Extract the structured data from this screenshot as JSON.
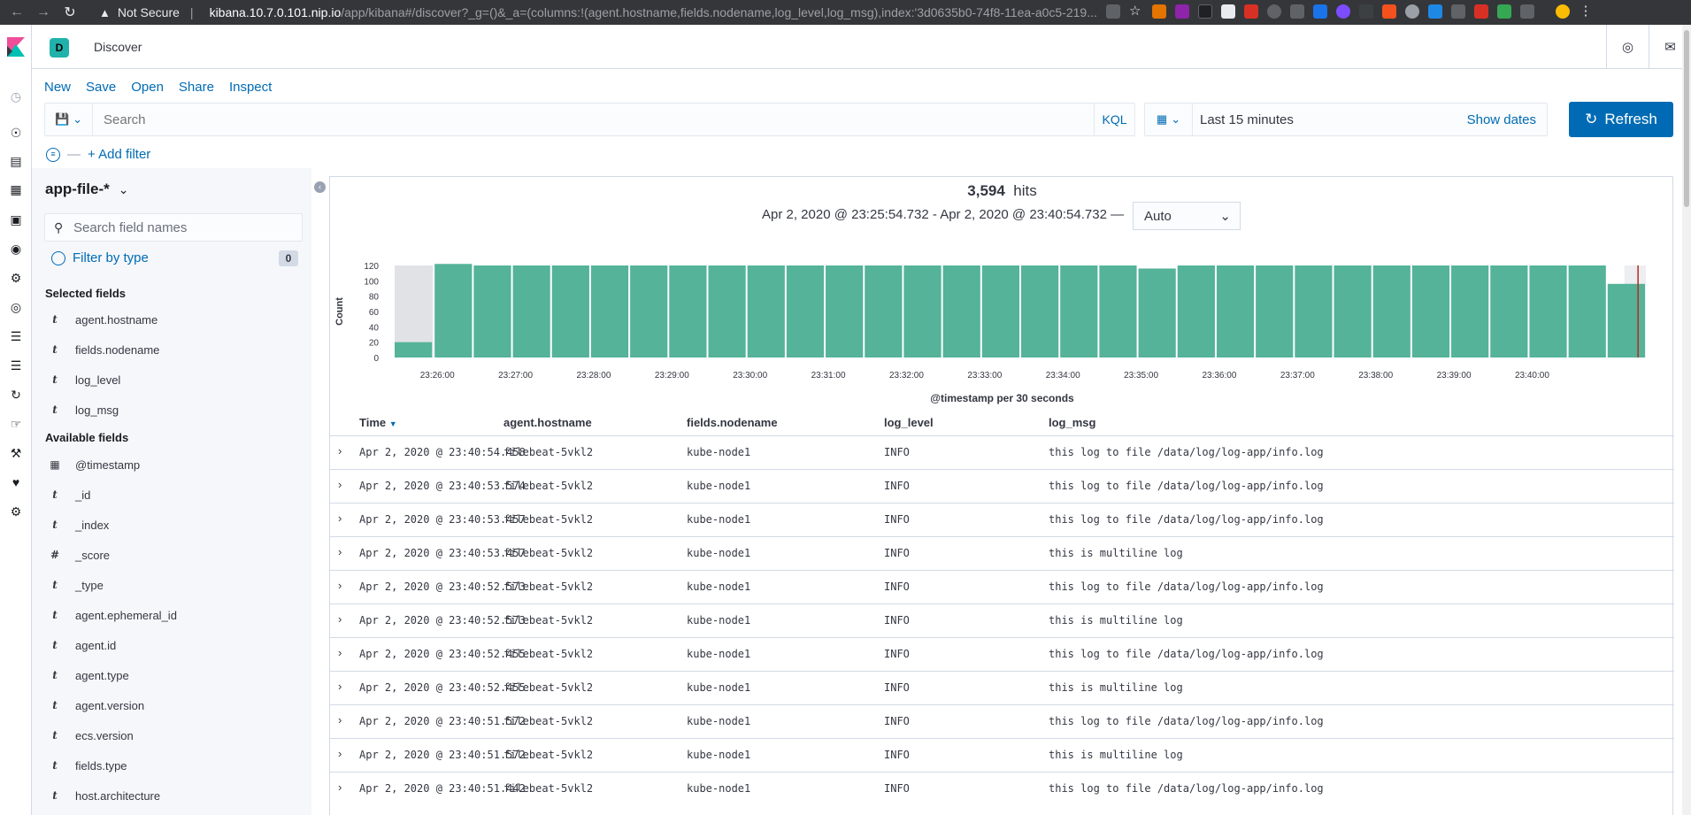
{
  "browser": {
    "security_label": "Not Secure",
    "url_host": "kibana.10.7.0.101.nip.io",
    "url_path": "/app/kibana#/discover?_g=()&_a=(columns:!(agent.hostname,fields.nodename,log_level,log_msg),index:'3d0635b0-74f8-11ea-a0c5-219..."
  },
  "header": {
    "space_initial": "D",
    "breadcrumb": "Discover"
  },
  "top_menu": {
    "new": "New",
    "save": "Save",
    "open": "Open",
    "share": "Share",
    "inspect": "Inspect"
  },
  "query": {
    "placeholder": "Search",
    "language": "KQL"
  },
  "time": {
    "range": "Last 15 minutes",
    "show_dates": "Show dates",
    "refresh": "Refresh"
  },
  "filter": {
    "add": "+ Add filter"
  },
  "sidebar": {
    "index_pattern": "app-file-*",
    "field_search_placeholder": "Search field names",
    "filter_by_type": "Filter by type",
    "filter_count": "0",
    "selected_title": "Selected fields",
    "selected": [
      {
        "type": "t",
        "name": "agent.hostname"
      },
      {
        "type": "t",
        "name": "fields.nodename"
      },
      {
        "type": "t",
        "name": "log_level"
      },
      {
        "type": "t",
        "name": "log_msg"
      }
    ],
    "available_title": "Available fields",
    "available": [
      {
        "type": "date",
        "name": "@timestamp"
      },
      {
        "type": "t",
        "name": "_id"
      },
      {
        "type": "t",
        "name": "_index"
      },
      {
        "type": "#",
        "name": "_score"
      },
      {
        "type": "t",
        "name": "_type"
      },
      {
        "type": "t",
        "name": "agent.ephemeral_id"
      },
      {
        "type": "t",
        "name": "agent.id"
      },
      {
        "type": "t",
        "name": "agent.type"
      },
      {
        "type": "t",
        "name": "agent.version"
      },
      {
        "type": "t",
        "name": "ecs.version"
      },
      {
        "type": "t",
        "name": "fields.type"
      },
      {
        "type": "t",
        "name": "host.architecture"
      }
    ]
  },
  "results": {
    "hits_count": "3,594",
    "hits_label": "hits",
    "time_span": "Apr 2, 2020 @ 23:25:54.732 - Apr 2, 2020 @ 23:40:54.732 —",
    "interval": "Auto"
  },
  "chart_data": {
    "type": "bar",
    "title": "",
    "xlabel": "@timestamp per 30 seconds",
    "ylabel": "Count",
    "ylim": [
      0,
      120
    ],
    "yticks": [
      "0",
      "20",
      "40",
      "60",
      "80",
      "100",
      "120"
    ],
    "x_tick_labels": [
      "23:26:00",
      "23:27:00",
      "23:28:00",
      "23:29:00",
      "23:30:00",
      "23:31:00",
      "23:32:00",
      "23:33:00",
      "23:34:00",
      "23:35:00",
      "23:36:00",
      "23:37:00",
      "23:38:00",
      "23:39:00",
      "23:40:00"
    ],
    "values": [
      20,
      122,
      120,
      120,
      120,
      120,
      120,
      120,
      120,
      120,
      120,
      120,
      120,
      120,
      120,
      120,
      120,
      120,
      120,
      116,
      120,
      120,
      120,
      120,
      120,
      120,
      120,
      120,
      120,
      120,
      120,
      96
    ],
    "bar_color": "#54b399",
    "out_of_range_color": "#e0e2e6",
    "now_marker_color": "#bd271e"
  },
  "table": {
    "columns": [
      "Time",
      "agent.hostname",
      "fields.nodename",
      "log_level",
      "log_msg"
    ],
    "rows": [
      [
        "Apr 2, 2020 @ 23:40:54.458",
        "filebeat-5vkl2",
        "kube-node1",
        "INFO",
        "this log to file /data/log/log-app/info.log"
      ],
      [
        "Apr 2, 2020 @ 23:40:53.574",
        "filebeat-5vkl2",
        "kube-node1",
        "INFO",
        "this log to file /data/log/log-app/info.log"
      ],
      [
        "Apr 2, 2020 @ 23:40:53.457",
        "filebeat-5vkl2",
        "kube-node1",
        "INFO",
        "this log to file /data/log/log-app/info.log"
      ],
      [
        "Apr 2, 2020 @ 23:40:53.457",
        "filebeat-5vkl2",
        "kube-node1",
        "INFO",
        "this is multiline log"
      ],
      [
        "Apr 2, 2020 @ 23:40:52.573",
        "filebeat-5vkl2",
        "kube-node1",
        "INFO",
        "this log to file /data/log/log-app/info.log"
      ],
      [
        "Apr 2, 2020 @ 23:40:52.573",
        "filebeat-5vkl2",
        "kube-node1",
        "INFO",
        "this is multiline log"
      ],
      [
        "Apr 2, 2020 @ 23:40:52.455",
        "filebeat-5vkl2",
        "kube-node1",
        "INFO",
        "this log to file /data/log/log-app/info.log"
      ],
      [
        "Apr 2, 2020 @ 23:40:52.455",
        "filebeat-5vkl2",
        "kube-node1",
        "INFO",
        "this is multiline log"
      ],
      [
        "Apr 2, 2020 @ 23:40:51.572",
        "filebeat-5vkl2",
        "kube-node1",
        "INFO",
        "this log to file /data/log/log-app/info.log"
      ],
      [
        "Apr 2, 2020 @ 23:40:51.572",
        "filebeat-5vkl2",
        "kube-node1",
        "INFO",
        "this is multiline log"
      ],
      [
        "Apr 2, 2020 @ 23:40:51.442",
        "filebeat-5vkl2",
        "kube-node1",
        "INFO",
        "this log to file /data/log/log-app/info.log"
      ]
    ]
  },
  "colors": {
    "link": "#006bb4",
    "primary_button": "#006bb4",
    "space_badge": "#20b2aa"
  }
}
